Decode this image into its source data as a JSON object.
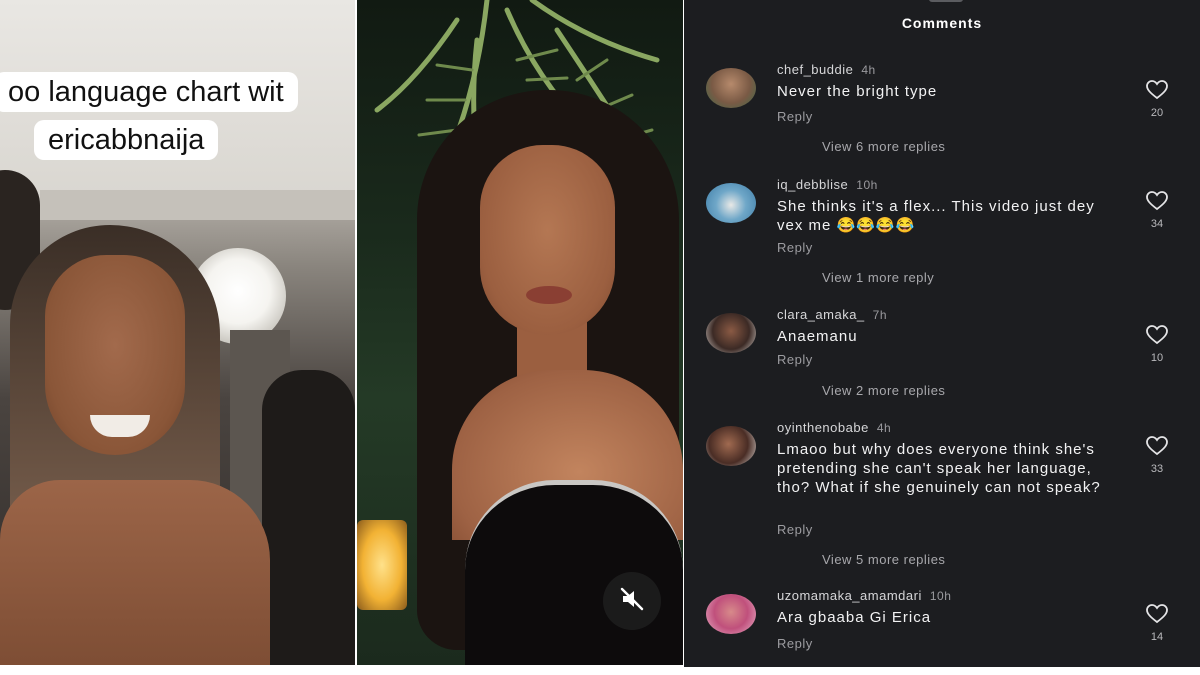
{
  "left_video": {
    "caption_line1": "oo language chart wit",
    "caption_line2": "ericabbnaija"
  },
  "mid_image": {
    "mute_icon": "speaker-muted-icon"
  },
  "comments_panel": {
    "title": "Comments",
    "comments": [
      {
        "username": "chef_buddie",
        "time": "4h",
        "text": "Never the bright type",
        "reply_label": "Reply",
        "view_replies": "View 6 more replies",
        "likes": "20"
      },
      {
        "username": "iq_debblise",
        "time": "10h",
        "text": "She thinks it's a flex... This video just dey vex me 😂😂😂😂",
        "reply_label": "Reply",
        "view_replies": "View 1 more reply",
        "likes": "34"
      },
      {
        "username": "clara_amaka_",
        "time": "7h",
        "text": "Anaemanu",
        "reply_label": "Reply",
        "view_replies": "View 2 more replies",
        "likes": "10"
      },
      {
        "username": "oyinthenobabe",
        "time": "4h",
        "text": "Lmaoo but why does everyone think she's pretending she can't speak her language, tho? What if she genuinely can not speak?",
        "reply_label": "Reply",
        "view_replies": "View 5 more replies",
        "likes": "33"
      },
      {
        "username": "uzomamaka_amamdari",
        "time": "10h",
        "text": "Ara gbaaba Gi Erica",
        "reply_label": "Reply",
        "view_replies": "",
        "likes": "14"
      }
    ]
  },
  "colors": {
    "panel_bg": "#1c1d20",
    "caption_bg": "#ffffff",
    "text_primary": "#f2f2f3",
    "text_muted": "#9c9ca0"
  }
}
